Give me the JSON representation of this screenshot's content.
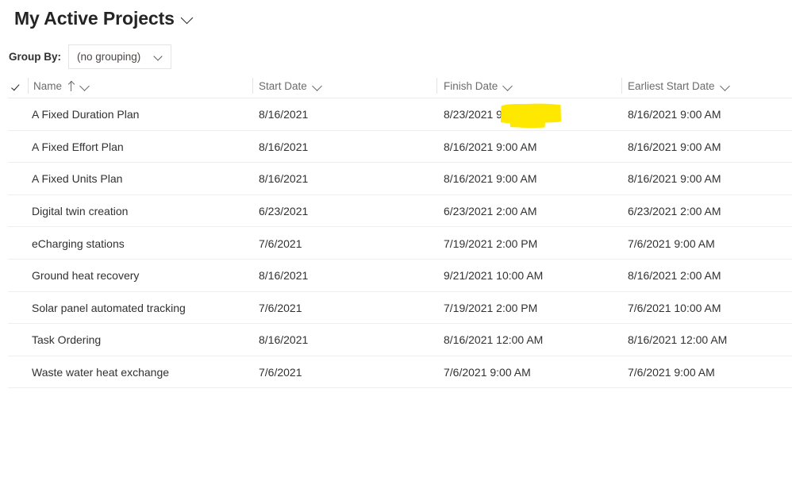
{
  "header": {
    "title": "My Active Projects",
    "title_chevron_icon": "chevron-down-icon"
  },
  "toolbar": {
    "group_by_label": "Group By:",
    "group_by_value": "(no grouping)",
    "group_by_chevron_icon": "chevron-down-icon",
    "group_by_options": [
      "(no grouping)"
    ]
  },
  "table": {
    "select_all_icon": "checkmark-icon",
    "columns": [
      {
        "label": "Name",
        "sort": "ascending",
        "sort_icon": "arrow-up-icon",
        "menu_icon": "chevron-down-icon"
      },
      {
        "label": "Start Date",
        "sort": "none",
        "menu_icon": "chevron-down-icon"
      },
      {
        "label": "Finish Date",
        "sort": "none",
        "menu_icon": "chevron-down-icon"
      },
      {
        "label": "Earliest Start Date",
        "sort": "none",
        "menu_icon": "chevron-down-icon"
      }
    ],
    "rows": [
      {
        "name": "A Fixed Duration Plan",
        "start_date": "8/16/2021",
        "finish_date": "8/23/2021 9:00 AM",
        "earliest_start_date": "8/16/2021 9:00 AM"
      },
      {
        "name": "A Fixed Effort Plan",
        "start_date": "8/16/2021",
        "finish_date": "8/16/2021 9:00 AM",
        "earliest_start_date": "8/16/2021 9:00 AM"
      },
      {
        "name": "A Fixed Units Plan",
        "start_date": "8/16/2021",
        "finish_date": "8/16/2021 9:00 AM",
        "earliest_start_date": "8/16/2021 9:00 AM"
      },
      {
        "name": "Digital twin creation",
        "start_date": "6/23/2021",
        "finish_date": "6/23/2021 2:00 AM",
        "earliest_start_date": "6/23/2021 2:00 AM"
      },
      {
        "name": "eCharging stations",
        "start_date": "7/6/2021",
        "finish_date": "7/19/2021 2:00 PM",
        "earliest_start_date": "7/6/2021 9:00 AM"
      },
      {
        "name": "Ground heat recovery",
        "start_date": "8/16/2021",
        "finish_date": "9/21/2021 10:00 AM",
        "earliest_start_date": "8/16/2021 2:00 AM"
      },
      {
        "name": "Solar panel automated tracking",
        "start_date": "7/6/2021",
        "finish_date": "7/19/2021 2:00 PM",
        "earliest_start_date": "7/6/2021 10:00 AM"
      },
      {
        "name": "Task Ordering",
        "start_date": "8/16/2021",
        "finish_date": "8/16/2021 12:00 AM",
        "earliest_start_date": "8/16/2021 12:00 AM"
      },
      {
        "name": "Waste water heat exchange",
        "start_date": "7/6/2021",
        "finish_date": "7/6/2021 9:00 AM",
        "earliest_start_date": "7/6/2021 9:00 AM"
      }
    ]
  },
  "annotation": {
    "type": "highlighter-mark",
    "color": "#FFE800",
    "highlighted_text": "9:00 AM",
    "target_row": "A Fixed Duration Plan",
    "target_column": "Finish Date"
  },
  "colors": {
    "text": "#323130",
    "header_text": "#6e6c6a",
    "divider": "#edebe9",
    "highlight": "#FFE800",
    "background": "#ffffff"
  }
}
